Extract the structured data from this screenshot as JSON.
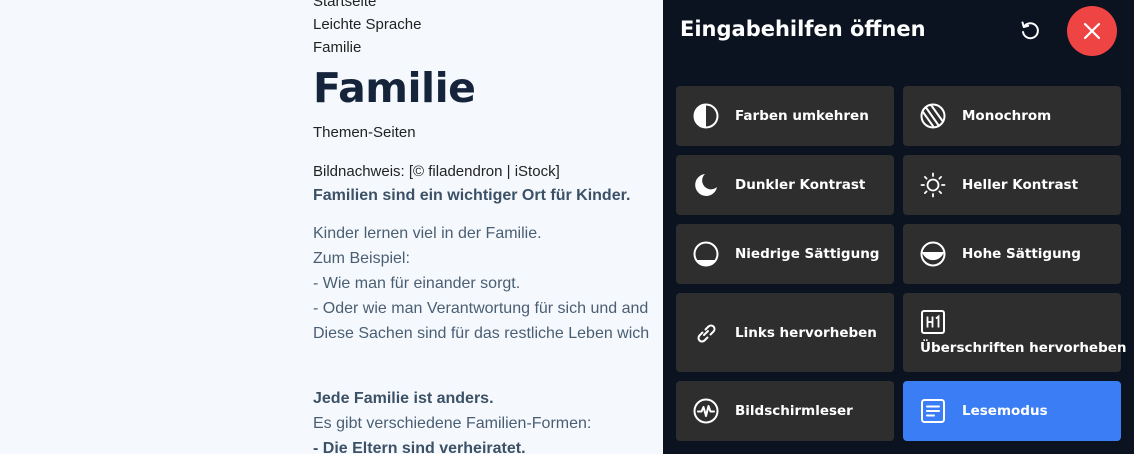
{
  "page": {
    "breadcrumb": [
      "Startseite",
      "Leichte Sprache",
      "Familie"
    ],
    "title": "Familie",
    "subtitle": "Themen-Seiten",
    "image_credit": "Bildnachweis: [© filadendron | iStock]",
    "lead": "Familien sind ein wichtiger Ort für Kinder.",
    "body_lines": [
      "Kinder lernen viel in der Familie.",
      "Zum Beispiel:",
      "-  Wie man für einander sorgt.",
      "-  Oder wie man Verantwortung für sich und and",
      "Diese Sachen sind für das restliche Leben wich"
    ],
    "section_heading": "Jede Familie ist anders.",
    "section_lines": [
      "Es gibt verschiedene Familien-Formen:",
      "-  Die Eltern sind verheiratet."
    ]
  },
  "panel": {
    "title": "Eingabehilfen öffnen",
    "reset_icon": "reset-icon",
    "close_icon": "close-icon",
    "close_color": "#ef4444",
    "active_color": "#3b7df5",
    "tiles": [
      {
        "label": "Farben umkehren",
        "icon": "invert-colors-icon"
      },
      {
        "label": "Monochrom",
        "icon": "monochrome-icon"
      },
      {
        "label": "Dunkler Kontrast",
        "icon": "moon-icon"
      },
      {
        "label": "Heller Kontrast",
        "icon": "sun-icon"
      },
      {
        "label": "Niedrige Sättigung",
        "icon": "low-saturation-icon"
      },
      {
        "label": "Hohe Sättigung",
        "icon": "high-saturation-icon"
      },
      {
        "label": "Links hervorheben",
        "icon": "link-icon"
      },
      {
        "label": "Überschriften hervorheben",
        "icon": "heading-icon"
      },
      {
        "label": "Bildschirmleser",
        "icon": "screen-reader-icon"
      },
      {
        "label": "Lesemodus",
        "icon": "reading-mode-icon",
        "active": true
      }
    ]
  }
}
